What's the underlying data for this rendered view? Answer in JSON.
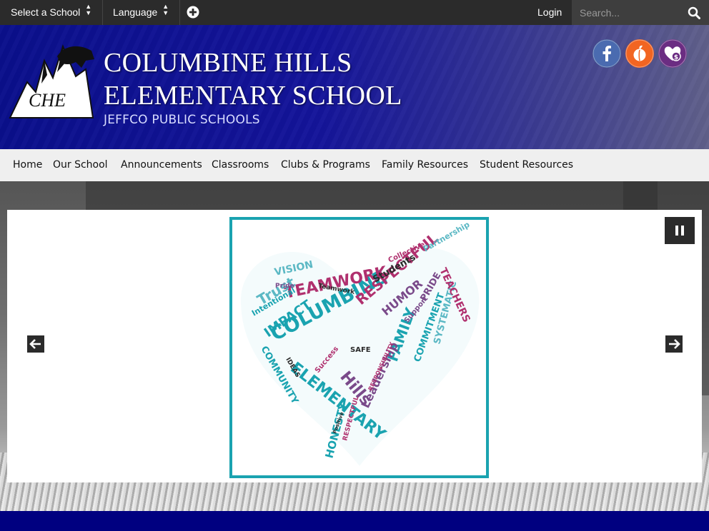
{
  "topbar": {
    "select_school": "Select a School",
    "language": "Language",
    "login": "Login",
    "search_placeholder": "Search..."
  },
  "header": {
    "logo_text": "CHE",
    "school_name_line1": "COLUMBINE HILLS",
    "school_name_line2": "ELEMENTARY SCHOOL",
    "district": "JEFFCO PUBLIC SCHOOLS"
  },
  "social": [
    {
      "icon": "facebook-icon",
      "color": "#3b5998"
    },
    {
      "icon": "peachjar-icon",
      "color": "#f26522"
    },
    {
      "icon": "donate-heart-icon",
      "color": "#6b2d82"
    }
  ],
  "nav": {
    "items": [
      "Home",
      "Our School",
      "Announcements",
      "Classrooms",
      "Clubs & Programs",
      "Family Resources",
      "Student Resources"
    ]
  },
  "slideshow": {
    "words": {
      "w1": "COLUMBINE",
      "w2": "Hills",
      "w3": "ELEMENTARY",
      "w4": "TEAMWORK",
      "w5": "RESPECTFUL",
      "w6": "FAMILY",
      "w7": "IMPACT",
      "w8": "Trust",
      "w9": "Leadership",
      "w10": "HUMOR",
      "w11": "COMMITMENT",
      "w12": "SYSTEMATIC",
      "w13": "TEACHERS",
      "w14": "HONESTY",
      "w15": "COMMUNITY",
      "w16": "VISION",
      "w17": "Students",
      "w18": "PRIDE",
      "w19": "Collective",
      "w20": "Partnership",
      "w21": "Intentional",
      "w22": "SAFE",
      "w23": "Success",
      "w24": "RESPONSIBILITY",
      "w25": "Support",
      "w26": "IDEAS",
      "w27": "RESPECTFUL",
      "w28": "Teamwork",
      "w29": "Pride",
      "w30": "Positive"
    }
  },
  "colors": {
    "topbar": "#2b2b2b",
    "header_blue": "#0a0f8c",
    "nav_bg": "#efefef",
    "slide_border": "#1aa3b0",
    "footer": "#000080"
  }
}
